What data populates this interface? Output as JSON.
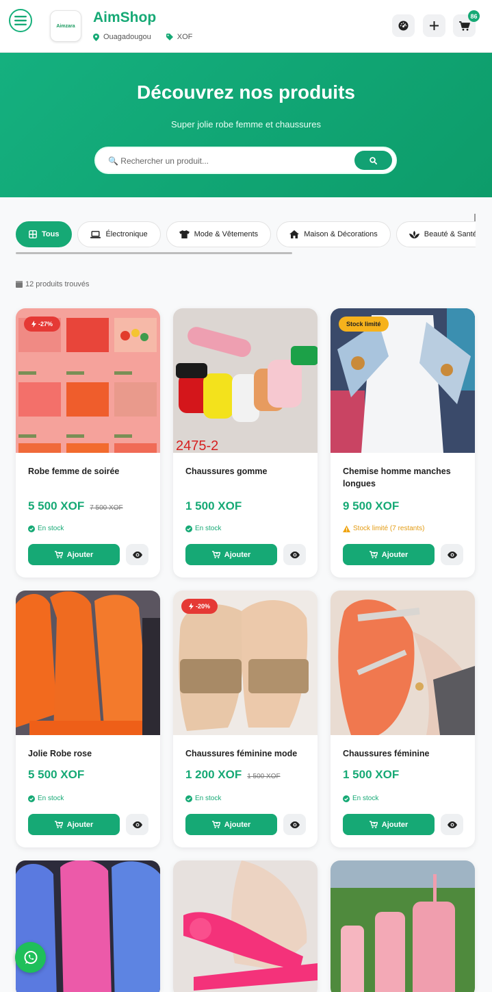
{
  "header": {
    "brand": "AimShop",
    "logo_text": "Aimzara",
    "location": "Ouagadougou",
    "currency": "XOF",
    "cart_count": "86",
    "accent": "#16a975"
  },
  "hero": {
    "title": "Découvrez nos produits",
    "subtitle": "Super jolie robe femme et chaussures",
    "search_placeholder": "🔍 Rechercher un produit..."
  },
  "categories": [
    {
      "label": "Tous",
      "icon": "grid-icon",
      "active": true
    },
    {
      "label": "Électronique",
      "icon": "laptop-icon"
    },
    {
      "label": "Mode & Vêtements",
      "icon": "tshirt-icon"
    },
    {
      "label": "Maison & Décorations",
      "icon": "home-icon"
    },
    {
      "label": "Beauté & Santé",
      "icon": "spa-icon"
    }
  ],
  "results_count": "12 produits trouvés",
  "buttons": {
    "add": "Ajouter"
  },
  "products": [
    {
      "name": "Robe femme de soirée",
      "price": "5 500 XOF",
      "old_price": "7 500 XOF",
      "badge": "-27%",
      "stock": "En stock"
    },
    {
      "name": "Chaussures gomme",
      "price": "1 500 XOF",
      "stock": "En stock",
      "image_text": "2475-2"
    },
    {
      "name": "Chemise homme manches longues",
      "price": "9 500 XOF",
      "badge": "Stock limité",
      "stock": "Stock limité (7 restants)"
    },
    {
      "name": "Jolie Robe rose",
      "price": "5 500 XOF",
      "stock": "En stock"
    },
    {
      "name": "Chaussures féminine mode",
      "price": "1 200 XOF",
      "old_price": "1 500 XOF",
      "badge": "-20%",
      "stock": "En stock"
    },
    {
      "name": "Chaussures féminine",
      "price": "1 500 XOF",
      "stock": "En stock"
    },
    {
      "name": "",
      "price": ""
    },
    {
      "name": "",
      "price": ""
    },
    {
      "name": "",
      "price": ""
    }
  ]
}
